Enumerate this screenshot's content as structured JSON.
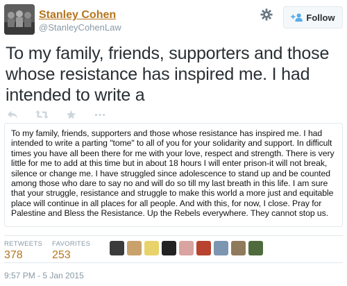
{
  "profile": {
    "name": "Stanley Cohen",
    "handle": "@StanleyCohenLaw"
  },
  "follow_label": "Follow",
  "tweet": {
    "text": "To my family, friends, supporters and those whose resistance has inspired me. I had intended to write a"
  },
  "actions": [
    "reply-icon",
    "retweet-icon",
    "favorite-icon",
    "more-icon"
  ],
  "attached_image_text": "To my family, friends, supporters and those whose resistance has inspired me. I had intended to write a parting \"tome\" to all of you for your solidarity and support. In difficult times you have all been there for me with your love, respect and strength. There is very little for me to add at this time but in about 18 hours I will enter prison-it will not break, silence or change me. I have struggled since adolescence to stand up and be counted among those who dare to say no and will do so till my last breath in this life. I am sure that your struggle, resistance and struggle to make this world a more just and equitable place will continue in all places for all people. And with this, for now, I close. Pray for Palestine and Bless the Resistance. Up the Rebels everywhere. They cannot stop us.",
  "stats": {
    "retweets_label": "RETWEETS",
    "retweets": "378",
    "favorites_label": "FAVORITES",
    "favorites": "253"
  },
  "favoriter_avatars": [
    "#3b3b3b",
    "#c9a26b",
    "#e7d36a",
    "#222222",
    "#d9a3a0",
    "#b8432f",
    "#7c95b0",
    "#8f7a5c",
    "#4f6b3d"
  ],
  "timestamp": "9:57 PM - 5 Jan 2015",
  "colors": {
    "link": "#b5741c",
    "muted": "#8899a6",
    "follow_icon": "#55acee"
  }
}
